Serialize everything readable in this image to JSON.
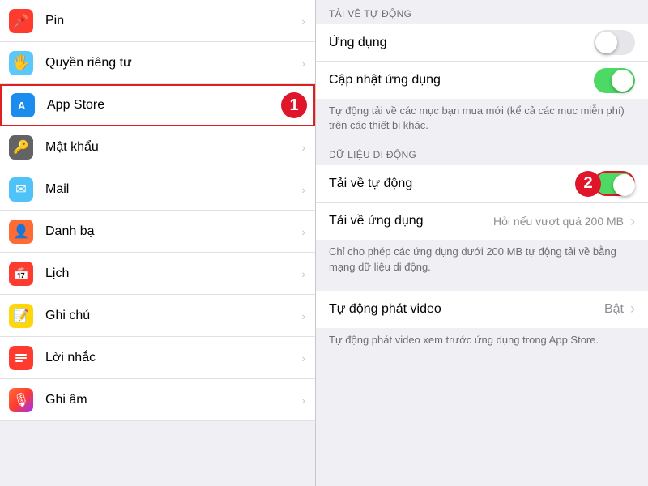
{
  "left": {
    "items": [
      {
        "id": "pin",
        "label": "Pin",
        "iconClass": "icon-pin",
        "iconSymbol": "📌",
        "highlighted": false
      },
      {
        "id": "privacy",
        "label": "Quyền riêng tư",
        "iconClass": "icon-privacy",
        "iconSymbol": "🖐",
        "highlighted": false
      },
      {
        "id": "appstore",
        "label": "App Store",
        "iconClass": "icon-appstore",
        "iconSymbol": "A",
        "highlighted": true,
        "badge": "1"
      },
      {
        "id": "password",
        "label": "Mật khẩu",
        "iconClass": "icon-password",
        "iconSymbol": "🔑",
        "highlighted": false
      },
      {
        "id": "mail",
        "label": "Mail",
        "iconClass": "icon-mail",
        "iconSymbol": "✉",
        "highlighted": false
      },
      {
        "id": "contacts",
        "label": "Danh bạ",
        "iconClass": "icon-contacts",
        "iconSymbol": "👤",
        "highlighted": false
      },
      {
        "id": "calendar",
        "label": "Lịch",
        "iconClass": "icon-calendar",
        "iconSymbol": "📅",
        "highlighted": false
      },
      {
        "id": "notes",
        "label": "Ghi chú",
        "iconClass": "icon-notes",
        "iconSymbol": "📝",
        "highlighted": false
      },
      {
        "id": "reminders",
        "label": "Lời nhắc",
        "iconClass": "icon-reminders",
        "iconSymbol": "☰",
        "highlighted": false
      },
      {
        "id": "voice",
        "label": "Ghi âm",
        "iconClass": "icon-voice",
        "iconSymbol": "🎙",
        "highlighted": false
      }
    ]
  },
  "right": {
    "section1": {
      "header": "TẢI VỀ TỰ ĐỘNG",
      "items": [
        {
          "id": "apps",
          "label": "Ứng dụng",
          "toggle": true,
          "toggleState": "off"
        },
        {
          "id": "app-updates",
          "label": "Cập nhật ứng dụng",
          "toggle": true,
          "toggleState": "on"
        }
      ],
      "note": "Tự động tải về các mục bạn mua mới (kể cả các mục miễn phí) trên các thiết bị khác."
    },
    "section2": {
      "header": "DỮ LIỆU DI ĐỘNG",
      "items": [
        {
          "id": "auto-download",
          "label": "Tải về tự động",
          "toggle": true,
          "toggleState": "on",
          "badge": "2",
          "badgeHighlight": true
        },
        {
          "id": "app-size",
          "label": "Tải về ứng dụng",
          "value": "Hỏi nếu vượt quá 200 MB",
          "toggle": false,
          "chevron": true
        }
      ],
      "note1": "Chỉ cho phép các ứng dụng dưới 200 MB tự động tải về bằng mạng dữ liệu di động."
    },
    "section3": {
      "items": [
        {
          "id": "autoplay-video",
          "label": "Tự động phát video",
          "value": "Bật",
          "toggle": false,
          "chevron": true
        }
      ],
      "note2": "Tự động phát video xem trước ứng dụng trong App Store."
    }
  },
  "icons": {
    "chevron": "›"
  }
}
